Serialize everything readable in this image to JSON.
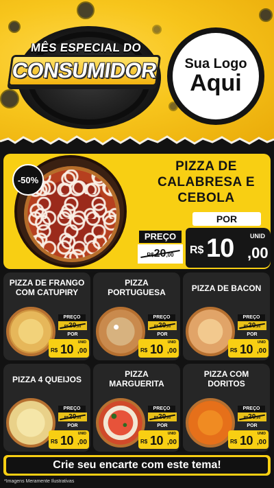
{
  "header": {
    "title_top": "MÊS ESPECIAL DO",
    "title_main": "CONSUMIDOR",
    "logo_line1": "Sua Logo",
    "logo_line2": "Aqui"
  },
  "feature": {
    "discount": "-50%",
    "name_line1": "PIZZA DE",
    "name_line2": "CALABRESA E",
    "name_line3": "CEBOLA",
    "preco_label": "PREÇO",
    "old_currency": "R$",
    "old_price": "20",
    "old_cents": ",00",
    "por_label": "POR",
    "unid_label": "UNID",
    "currency": "R$",
    "price_int": "10",
    "price_dec": ",00"
  },
  "products": [
    {
      "line1": "PIZZA DE FRANGO",
      "line2": "COM CATUPIRY",
      "preco_label": "PREÇO",
      "old_currency": "R$",
      "old_price": "20",
      "old_cents": ",00",
      "por_label": "POR",
      "unid_label": "UNID",
      "currency": "R$",
      "price_int": "10",
      "price_dec": ",00"
    },
    {
      "line1": "PIZZA",
      "line2": "PORTUGUESA",
      "preco_label": "PREÇO",
      "old_currency": "R$",
      "old_price": "20",
      "old_cents": ",00",
      "por_label": "POR",
      "unid_label": "UNID",
      "currency": "R$",
      "price_int": "10",
      "price_dec": ",00"
    },
    {
      "line1": "PIZZA DE BACON",
      "line2": "",
      "preco_label": "PREÇO",
      "old_currency": "R$",
      "old_price": "20",
      "old_cents": ",00",
      "por_label": "POR",
      "unid_label": "UNID",
      "currency": "R$",
      "price_int": "10",
      "price_dec": ",00"
    },
    {
      "line1": "PIZZA 4 QUEIJOS",
      "line2": "",
      "preco_label": "PREÇO",
      "old_currency": "R$",
      "old_price": "20",
      "old_cents": ",00",
      "por_label": "POR",
      "unid_label": "UNID",
      "currency": "R$",
      "price_int": "10",
      "price_dec": ",00"
    },
    {
      "line1": "PIZZA",
      "line2": "MARGUERITA",
      "preco_label": "PREÇO",
      "old_currency": "R$",
      "old_price": "20",
      "old_cents": ",00",
      "por_label": "POR",
      "unid_label": "UNID",
      "currency": "R$",
      "price_int": "10",
      "price_dec": ",00"
    },
    {
      "line1": "PIZZA COM",
      "line2": "DORITOS",
      "preco_label": "PREÇO",
      "old_currency": "R$",
      "old_price": "20",
      "old_cents": ",00",
      "por_label": "POR",
      "unid_label": "UNID",
      "currency": "R$",
      "price_int": "10",
      "price_dec": ",00"
    }
  ],
  "footer": {
    "cta": "Crie seu encarte com este tema!",
    "disclaimer": "*Imagens Meramente Ilustrativas"
  },
  "colors": {
    "accent_yellow": "#f8cf13",
    "dark": "#121212",
    "card": "#262626"
  }
}
